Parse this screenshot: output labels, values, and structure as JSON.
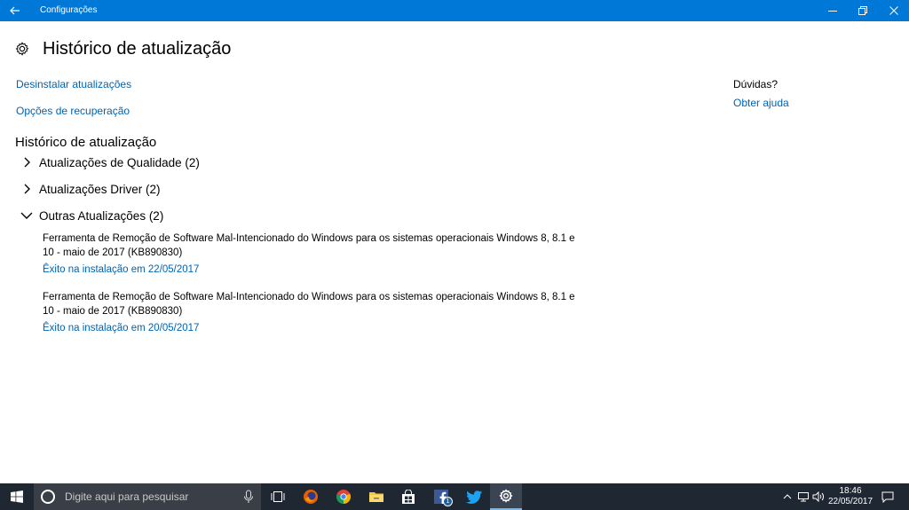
{
  "window": {
    "title": "Configurações",
    "accent_color": "#0078d7"
  },
  "page": {
    "title": "Histórico de atualização"
  },
  "links": {
    "uninstall": "Desinstalar atualizações",
    "recovery": "Opções de recuperação"
  },
  "history": {
    "heading": "Histórico de atualização",
    "groups": [
      {
        "label": "Atualizações de Qualidade (2)",
        "expanded": false
      },
      {
        "label": "Atualizações Driver (2)",
        "expanded": false
      },
      {
        "label": "Outras Atualizações (2)",
        "expanded": true
      }
    ],
    "items": [
      {
        "name": "Ferramenta de Remoção de Software Mal-Intencionado do Windows para os sistemas operacionais Windows 8, 8.1 e 10 - maio de 2017 (KB890830)",
        "status": "Êxito na instalação em 22/05/2017"
      },
      {
        "name": "Ferramenta de Remoção de Software Mal-Intencionado do Windows para os sistemas operacionais Windows 8, 8.1 e 10 - maio de 2017 (KB890830)",
        "status": "Êxito na instalação em 20/05/2017"
      }
    ]
  },
  "help": {
    "title": "Dúvidas?",
    "link": "Obter ajuda"
  },
  "taskbar": {
    "search_placeholder": "Digite aqui para pesquisar",
    "apps": [
      "task-view-icon",
      "firefox-icon",
      "chrome-icon",
      "file-explorer-icon",
      "store-icon",
      "facebook-icon",
      "twitter-icon",
      "settings-icon"
    ],
    "facebook_badge": "1",
    "time": "18:46",
    "date": "22/05/2017"
  }
}
